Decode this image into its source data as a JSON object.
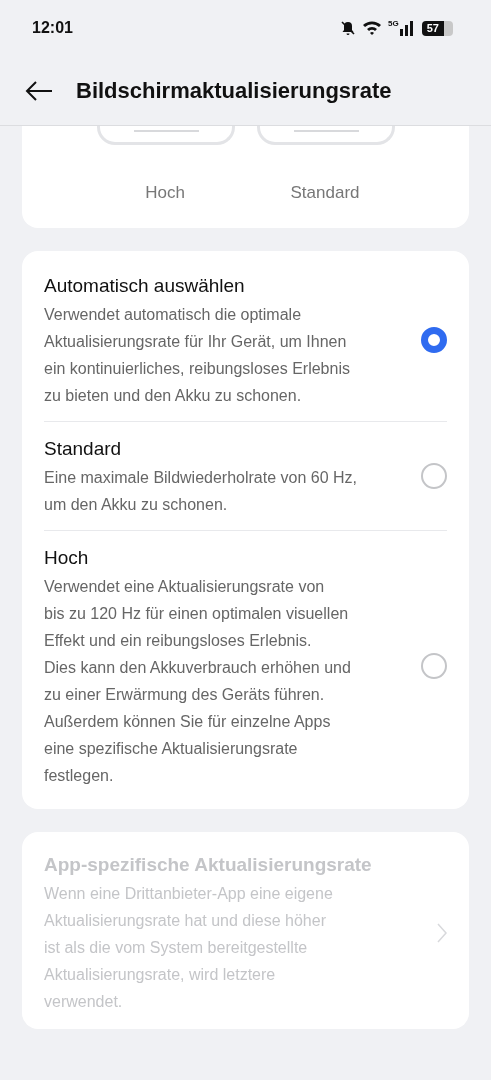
{
  "status_bar": {
    "time": "12:01",
    "network": "5G",
    "battery": "57"
  },
  "header": {
    "title": "Bildschirmaktualisierungsrate"
  },
  "preview": {
    "options": [
      {
        "label": "Hoch"
      },
      {
        "label": "Standard"
      }
    ]
  },
  "options": [
    {
      "title": "Automatisch auswählen",
      "description": "Verwendet automatisch die optimale\nAktualisierungsrate für Ihr Gerät, um Ihnen\nein kontinuierliches, reibungsloses Erlebnis\nzu bieten und den Akku zu schonen.",
      "selected": true
    },
    {
      "title": "Standard",
      "description": "Eine maximale Bildwiederholrate von 60 Hz,\num den Akku zu schonen.",
      "selected": false
    },
    {
      "title": "Hoch",
      "description": "Verwendet eine Aktualisierungsrate von\nbis zu 120 Hz für einen optimalen visuellen\nEffekt und ein reibungsloses Erlebnis.\nDies kann den Akkuverbrauch erhöhen und\nzu einer Erwärmung des Geräts führen.\nAußerdem können Sie für einzelne Apps\neine spezifische Aktualisierungsrate\nfestlegen.",
      "selected": false
    }
  ],
  "app_specific": {
    "title": "App-spezifische Aktualisierungsrate",
    "description": "Wenn eine Drittanbieter-App eine eigene\nAktualisierungsrate hat und diese höher\nist als die vom System bereitgestellte\nAktualisierungsrate, wird letztere\nverwendet.",
    "disabled": true
  }
}
